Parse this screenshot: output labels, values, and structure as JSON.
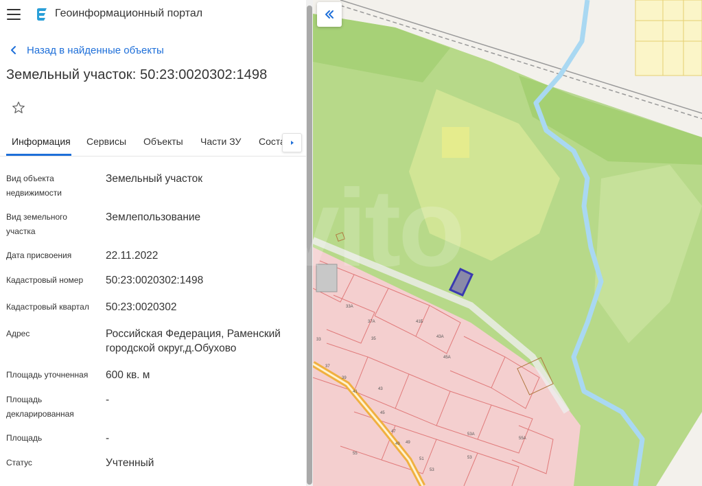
{
  "header": {
    "menu_icon": "hamburger-menu-icon",
    "logo_icon": "portal-logo-icon",
    "title": "Геоинформационный портал"
  },
  "back_link": {
    "label": "Назад в найденные объекты",
    "icon": "chevron-left-icon"
  },
  "object_title": "Земельный участок: 50:23:0020302:1498",
  "favorite_icon": "star-outline-icon",
  "tabs": [
    {
      "label": "Информация",
      "active": true
    },
    {
      "label": "Сервисы"
    },
    {
      "label": "Объекты"
    },
    {
      "label": "Части ЗУ"
    },
    {
      "label": "Соста"
    }
  ],
  "tabs_next_icon": "caret-right-icon",
  "info_rows": [
    {
      "label": "Вид объекта недвижимости",
      "value": "Земельный участок"
    },
    {
      "label": "Вид земельного участка",
      "value": "Землепользование"
    },
    {
      "label": "Дата присвоения",
      "value": "22.11.2022"
    },
    {
      "label": "Кадастровый номер",
      "value": "50:23:0020302:1498"
    },
    {
      "label": "Кадастровый квартал",
      "value": "50:23:0020302"
    },
    {
      "label": "Адрес",
      "value": "Российская Федерация, Раменский городской округ,д.Обухово"
    },
    {
      "label": "Площадь уточненная",
      "value": "600 кв. м"
    },
    {
      "label": "Площадь декларированная",
      "value": "-"
    },
    {
      "label": "Площадь",
      "value": "-"
    },
    {
      "label": "Статус",
      "value": "Учтенный"
    }
  ],
  "map": {
    "collapse_icon": "double-chevron-left-icon",
    "watermark": "Avito",
    "house_numbers": [
      "33А",
      "37А",
      "35",
      "33",
      "37",
      "39",
      "41",
      "43",
      "45",
      "47",
      "49",
      "51",
      "53",
      "43А",
      "45А",
      "41Б",
      "53А",
      "55А",
      "55",
      "49",
      "53"
    ],
    "colors": {
      "forest": "#b7d989",
      "forest_dark": "#9ccc6a",
      "meadow": "#dcea9a",
      "parcels": "#f6c9c9",
      "parcel_border": "#e07a7a",
      "river": "#9fd4f0",
      "road": "#f0b040",
      "selected_parcel": "#3a3ab0"
    }
  }
}
